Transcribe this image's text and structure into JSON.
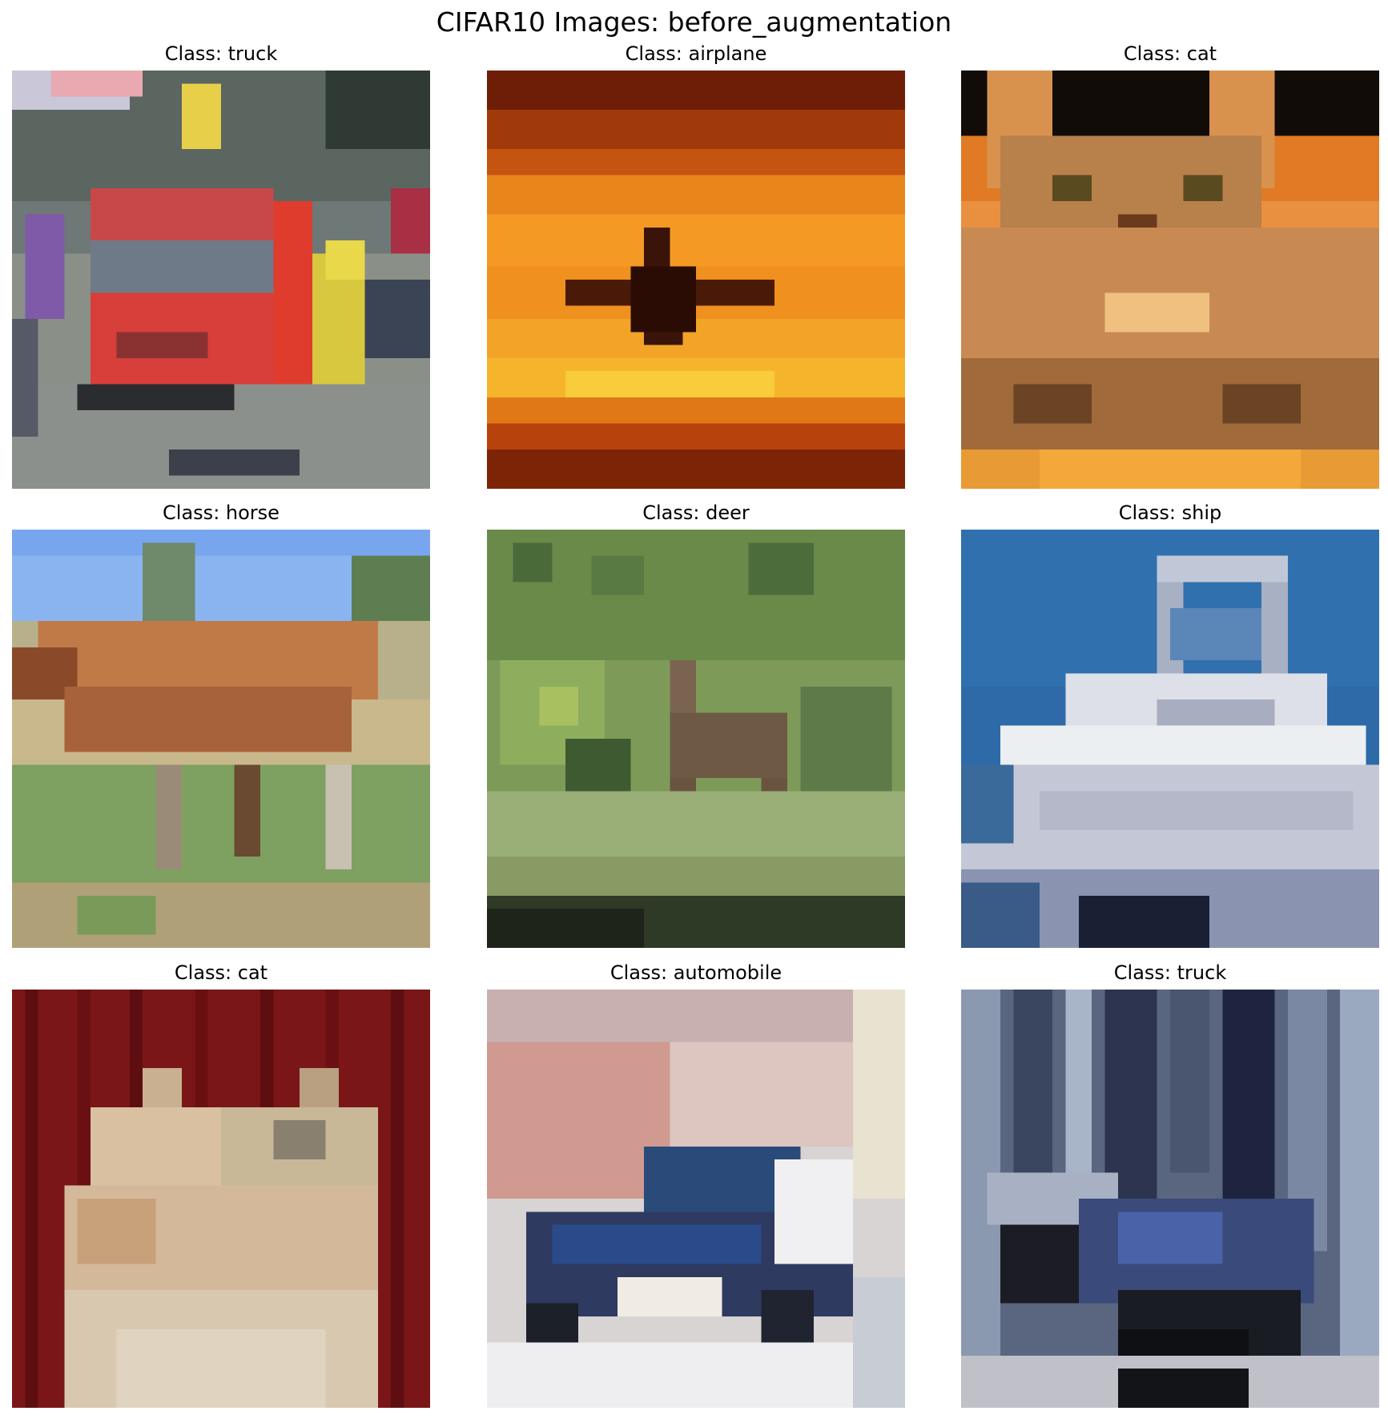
{
  "figure": {
    "title": "CIFAR10 Images: before_augmentation"
  },
  "panels": [
    {
      "title": "Class: truck",
      "content": "red truck on a street with people"
    },
    {
      "title": "Class: airplane",
      "content": "airplane silhouette against orange sunset sky"
    },
    {
      "title": "Class: cat",
      "content": "tabby cat on orange background"
    },
    {
      "title": "Class: horse",
      "content": "brown horse standing on grass under blue sky"
    },
    {
      "title": "Class: deer",
      "content": "small deer among green vegetation"
    },
    {
      "title": "Class: ship",
      "content": "white boat on blue water"
    },
    {
      "title": "Class: cat",
      "content": "two cream cats against red curtain"
    },
    {
      "title": "Class: automobile",
      "content": "dark blue car parked near a building"
    },
    {
      "title": "Class: truck",
      "content": "dark vehicle on grey-blue cluttered scene"
    }
  ]
}
